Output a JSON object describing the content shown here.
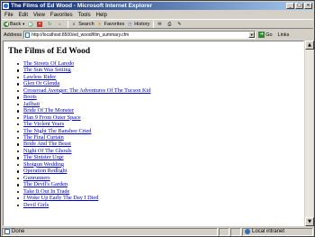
{
  "window": {
    "title": "The Films of Ed Wood - Microsoft Internet Explorer",
    "controls": {
      "minimize": "_",
      "maximize": "□",
      "close": "×"
    }
  },
  "menu": [
    "File",
    "Edit",
    "View",
    "Favorites",
    "Tools",
    "Help"
  ],
  "toolbar": {
    "back": "Back",
    "search": "Search",
    "favorites": "Favorites",
    "history": "History"
  },
  "address": {
    "label": "Address",
    "url": "http://localhost:8500/ed_wood/film_summary.cfm",
    "go": "Go",
    "links": "Links"
  },
  "page": {
    "heading": "The Films of Ed Wood",
    "films": [
      "The Streets Of Laredo",
      "The Sun Was Setting",
      "Lawless Rider",
      "Glen Or Glenda",
      "Crossroad Avenger: The Adventures Of The Tucson Kid",
      "Boots",
      "Jailbait",
      "Bride Of The Monster",
      "Plan 9 From Outer Space",
      "The Violent Years",
      "The Night The Banshee Cried",
      "The Final Curtain",
      "Bride And The Beast",
      "Night Of The Ghouls",
      "The Sinister Urge",
      "Shotgun Wedding",
      "Operation Redlight",
      "Gunrunners",
      "The Devil's Garden",
      "Take It Out In Trade",
      "I Woke Up Early The Day I Died",
      "Devil Girls"
    ]
  },
  "status": {
    "text": "Done",
    "zone": "Local intranet"
  },
  "colors": {
    "title_gradient_start": "#0a246a",
    "title_gradient_end": "#a6caf0",
    "link": "#0000cc",
    "chrome": "#d4d0c8"
  }
}
